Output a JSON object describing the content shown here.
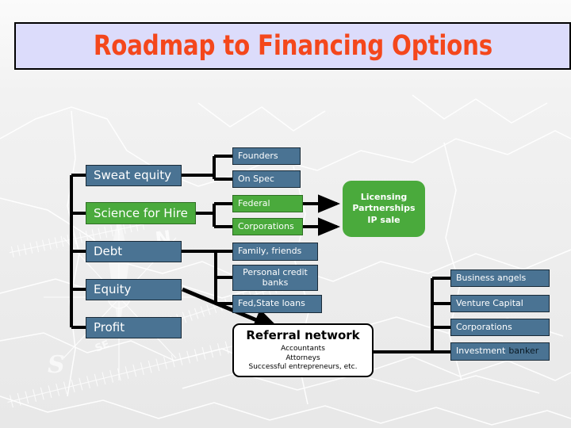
{
  "slide": {
    "title": "Roadmap to Financing Options",
    "title_color": "#f4471c",
    "title_band_color": "#dcdcfb",
    "background_color": "#ebebeb",
    "accent_blue": "#4a7393",
    "accent_green": "#4aaa3c"
  },
  "sources": [
    {
      "label": "Sweat equity",
      "color": "blue"
    },
    {
      "label": "Science for Hire",
      "color": "green"
    },
    {
      "label": "Debt",
      "color": "blue"
    },
    {
      "label": "Equity",
      "color": "blue"
    },
    {
      "label": "Profit",
      "color": "blue"
    }
  ],
  "options": [
    {
      "label": "Founders",
      "color": "blue"
    },
    {
      "label": "On Spec",
      "color": "blue"
    },
    {
      "label": "Federal",
      "color": "green"
    },
    {
      "label": "Corporations",
      "color": "green"
    },
    {
      "label": "Family, friends",
      "color": "blue"
    },
    {
      "label": "Personal credit banks",
      "color": "blue"
    },
    {
      "label": "Fed,State loans",
      "color": "blue"
    }
  ],
  "licensing": {
    "line1": "Licensing",
    "line2": "Partnerships",
    "line3": "IP sale"
  },
  "referral": {
    "title": "Referral network",
    "line1": "Accountants",
    "line2": "Attorneys",
    "line3": "Successful entrepreneurs, etc."
  },
  "investors": [
    {
      "label": "Business angels"
    },
    {
      "label": "Venture Capital"
    },
    {
      "label": "Corporations"
    },
    {
      "label_part1": "Investment",
      "label_part2": "banker"
    }
  ]
}
